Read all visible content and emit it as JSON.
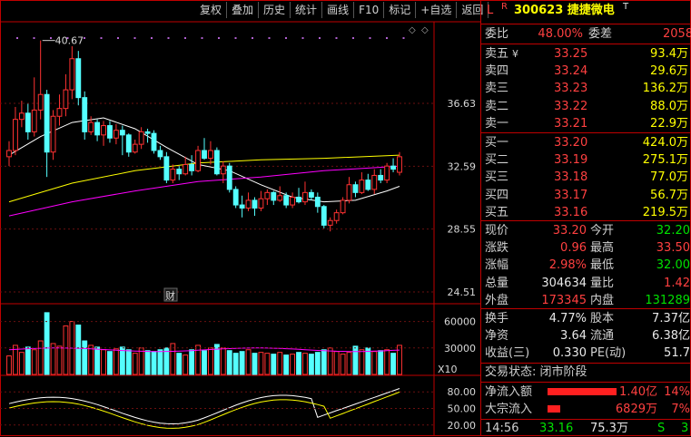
{
  "toolbar": {
    "buttons": [
      "复权",
      "叠加",
      "历史",
      "统计",
      "画线",
      "F10",
      "标记",
      "+自选",
      "返回"
    ]
  },
  "stock": {
    "flag_l": "L",
    "flag_r": "R",
    "code_name": "300623 捷捷微电",
    "flag_t": "T"
  },
  "ratio": {
    "label": "委比",
    "value": "48.00%",
    "diff_label": "委差",
    "diff_value": "2058"
  },
  "sells": [
    {
      "label": "卖五",
      "mark": "¥",
      "price": "33.25",
      "vol": "93.4万"
    },
    {
      "label": "卖四",
      "mark": "",
      "price": "33.24",
      "vol": "29.6万"
    },
    {
      "label": "卖三",
      "mark": "",
      "price": "33.23",
      "vol": "136.2万"
    },
    {
      "label": "卖二",
      "mark": "",
      "price": "33.22",
      "vol": "88.0万"
    },
    {
      "label": "卖一",
      "mark": "",
      "price": "33.21",
      "vol": "22.9万"
    }
  ],
  "buys": [
    {
      "label": "买一",
      "price": "33.20",
      "vol": "424.0万"
    },
    {
      "label": "买二",
      "price": "33.19",
      "vol": "275.1万"
    },
    {
      "label": "买三",
      "price": "33.18",
      "vol": "77.0万"
    },
    {
      "label": "买四",
      "price": "33.17",
      "vol": "56.7万"
    },
    {
      "label": "买五",
      "price": "33.16",
      "vol": "219.5万"
    }
  ],
  "quote": [
    {
      "l1": "现价",
      "v1": "33.20",
      "c1": "red",
      "l2": "今开",
      "v2": "32.20",
      "c2": "green"
    },
    {
      "l1": "涨跌",
      "v1": "0.96",
      "c1": "red",
      "l2": "最高",
      "v2": "33.50",
      "c2": "red"
    },
    {
      "l1": "涨幅",
      "v1": "2.98%",
      "c1": "red",
      "l2": "最低",
      "v2": "32.00",
      "c2": "green"
    },
    {
      "l1": "总量",
      "v1": "304634",
      "c1": "white",
      "l2": "量比",
      "v2": "1.42",
      "c2": "red"
    },
    {
      "l1": "外盘",
      "v1": "173345",
      "c1": "red",
      "l2": "内盘",
      "v2": "131289",
      "c2": "green"
    }
  ],
  "finance": [
    {
      "l1": "换手",
      "v1": "4.77%",
      "l2": "股本",
      "v2": "7.37亿"
    },
    {
      "l1": "净资",
      "v1": "3.64",
      "l2": "流通",
      "v2": "6.38亿"
    },
    {
      "l1": "收益(三)",
      "v1": "0.330",
      "l2": "PE(动)",
      "v2": "51.7"
    }
  ],
  "trade_status": "交易状态: 闭市阶段",
  "flows": [
    {
      "label": "净流入额",
      "value": "1.40亿",
      "pct": "14%",
      "bar": 0.95
    },
    {
      "label": "大宗流入",
      "value": "6829万",
      "pct": "7%",
      "bar": 0.18
    }
  ],
  "tick": {
    "time": "14:56",
    "price": "33.16",
    "vol": "75.3万",
    "dir": "S",
    "num": "3"
  },
  "chart_labels": {
    "high_label": "40.67",
    "price_ticks": [
      "36.63",
      "32.59",
      "28.55",
      "24.51"
    ],
    "vol_ticks": [
      "60000",
      "30000"
    ],
    "vol_unit": "X10",
    "ind_ticks": [
      "80.00",
      "50.00",
      "20.00"
    ],
    "cai_marker": "财"
  },
  "colors": {
    "up": "#ff3232",
    "down": "#54ffff",
    "ma5": "#ffffff",
    "ma10": "#ffff00",
    "ma20": "#ff00ff",
    "frame": "#c00000"
  },
  "chart_data": {
    "type": "candlestick",
    "price_ticks": [
      36.63,
      32.59,
      28.55,
      24.51
    ],
    "price_range": [
      24.51,
      36.63
    ],
    "high_label_value": 40.67,
    "candles": [
      [
        33.2,
        33.6,
        34.2,
        32.6
      ],
      [
        33.6,
        35.6,
        36.4,
        33.3
      ],
      [
        35.6,
        36.0,
        36.8,
        35.1
      ],
      [
        36.0,
        34.8,
        36.6,
        34.3
      ],
      [
        34.8,
        36.2,
        38.3,
        34.5
      ],
      [
        36.2,
        37.2,
        40.67,
        35.6
      ],
      [
        37.2,
        33.5,
        37.5,
        31.9
      ],
      [
        33.5,
        35.8,
        36.2,
        33.0
      ],
      [
        35.8,
        36.3,
        37.2,
        35.2
      ],
      [
        36.3,
        37.5,
        38.5,
        35.8
      ],
      [
        37.5,
        39.5,
        40.3,
        36.9
      ],
      [
        39.5,
        37.0,
        40.0,
        36.5
      ],
      [
        37.0,
        34.8,
        37.4,
        34.3
      ],
      [
        34.8,
        35.4,
        35.8,
        34.6
      ],
      [
        35.4,
        34.6,
        35.6,
        34.2
      ],
      [
        34.6,
        35.2,
        35.5,
        33.9
      ],
      [
        35.2,
        34.4,
        35.5,
        34.1
      ],
      [
        34.4,
        34.9,
        35.3,
        34.0
      ],
      [
        34.9,
        34.6,
        35.2,
        33.3
      ],
      [
        34.6,
        33.5,
        34.7,
        33.2
      ],
      [
        33.5,
        34.0,
        34.3,
        33.4
      ],
      [
        34.0,
        34.8,
        35.1,
        33.7
      ],
      [
        34.8,
        34.7,
        35.0,
        34.1
      ],
      [
        34.7,
        33.6,
        34.9,
        33.4
      ],
      [
        33.6,
        33.2,
        33.9,
        33.0
      ],
      [
        33.2,
        31.7,
        33.5,
        31.5
      ],
      [
        31.7,
        32.4,
        32.7,
        31.5
      ],
      [
        32.4,
        32.1,
        32.6,
        31.7
      ],
      [
        32.1,
        32.7,
        33.2,
        32.0
      ],
      [
        32.7,
        32.3,
        33.3,
        32.0
      ],
      [
        32.3,
        33.6,
        33.9,
        32.2
      ],
      [
        33.6,
        33.1,
        34.4,
        33.0
      ],
      [
        33.1,
        33.6,
        34.2,
        32.7
      ],
      [
        33.6,
        32.1,
        33.8,
        32.0
      ],
      [
        32.1,
        32.6,
        32.9,
        31.5
      ],
      [
        32.6,
        31.1,
        32.8,
        30.9
      ],
      [
        31.1,
        30.1,
        31.3,
        29.9
      ],
      [
        30.1,
        29.9,
        30.7,
        29.3
      ],
      [
        29.9,
        30.4,
        30.9,
        29.7
      ],
      [
        30.4,
        29.9,
        30.6,
        29.4
      ],
      [
        29.9,
        30.5,
        31.0,
        29.7
      ],
      [
        30.5,
        30.9,
        31.1,
        30.1
      ],
      [
        30.9,
        30.4,
        31.0,
        30.1
      ],
      [
        30.4,
        30.7,
        31.3,
        30.3
      ],
      [
        30.7,
        30.1,
        30.9,
        29.9
      ],
      [
        30.1,
        30.6,
        30.9,
        29.9
      ],
      [
        30.6,
        30.3,
        31.2,
        30.2
      ],
      [
        30.3,
        30.9,
        31.6,
        30.1
      ],
      [
        30.9,
        30.6,
        31.1,
        30.4
      ],
      [
        30.6,
        30.0,
        30.9,
        29.6
      ],
      [
        30.0,
        28.8,
        30.1,
        28.6
      ],
      [
        28.8,
        29.1,
        29.3,
        28.4
      ],
      [
        29.1,
        29.6,
        29.8,
        28.9
      ],
      [
        29.6,
        30.4,
        30.6,
        29.5
      ],
      [
        30.4,
        31.4,
        31.9,
        30.2
      ],
      [
        31.4,
        30.9,
        31.6,
        30.6
      ],
      [
        30.9,
        31.7,
        32.2,
        30.8
      ],
      [
        31.7,
        31.1,
        32.1,
        31.0
      ],
      [
        31.1,
        32.0,
        32.4,
        30.8
      ],
      [
        32.0,
        31.7,
        32.4,
        31.5
      ],
      [
        31.7,
        32.6,
        32.8,
        31.5
      ],
      [
        32.6,
        32.4,
        33.1,
        32.2
      ],
      [
        32.2,
        33.2,
        33.5,
        32.0
      ]
    ],
    "ma_lines": {
      "ma_white": [
        [
          0,
          33.3
        ],
        [
          5,
          34.5
        ],
        [
          10,
          35.4
        ],
        [
          15,
          35.7
        ],
        [
          20,
          35.0
        ],
        [
          25,
          33.8
        ],
        [
          30,
          32.7
        ],
        [
          35,
          32.3
        ],
        [
          40,
          31.4
        ],
        [
          45,
          30.6
        ],
        [
          50,
          30.3
        ],
        [
          55,
          30.4
        ],
        [
          60,
          31.0
        ],
        [
          62,
          31.3
        ]
      ],
      "ma_yellow": [
        [
          0,
          30.3
        ],
        [
          10,
          31.5
        ],
        [
          20,
          32.3
        ],
        [
          30,
          32.8
        ],
        [
          40,
          33.0
        ],
        [
          50,
          33.1
        ],
        [
          62,
          33.3
        ]
      ],
      "ma_magenta": [
        [
          0,
          29.4
        ],
        [
          10,
          30.3
        ],
        [
          20,
          31.0
        ],
        [
          30,
          31.6
        ],
        [
          40,
          31.9
        ],
        [
          50,
          32.3
        ],
        [
          62,
          32.6
        ]
      ]
    },
    "volume_ticks": [
      60000,
      30000
    ],
    "volume_unit": "X10",
    "volume": [
      21000,
      33000,
      25000,
      31000,
      28000,
      38000,
      70000,
      35000,
      32000,
      55000,
      60000,
      56000,
      38000,
      33000,
      31000,
      28000,
      26000,
      29000,
      31000,
      28000,
      24000,
      30000,
      27000,
      26000,
      28000,
      30000,
      35000,
      24000,
      22000,
      28000,
      33000,
      27000,
      30000,
      34000,
      30000,
      27000,
      24000,
      26000,
      28000,
      24000,
      25000,
      24000,
      23000,
      25000,
      22000,
      23000,
      25000,
      24000,
      23000,
      25000,
      28000,
      30000,
      26000,
      23000,
      25000,
      32000,
      28000,
      30000,
      26000,
      27000,
      28000,
      24000,
      33000
    ],
    "indicator_ticks": [
      80.0,
      50.0,
      20.0
    ]
  }
}
